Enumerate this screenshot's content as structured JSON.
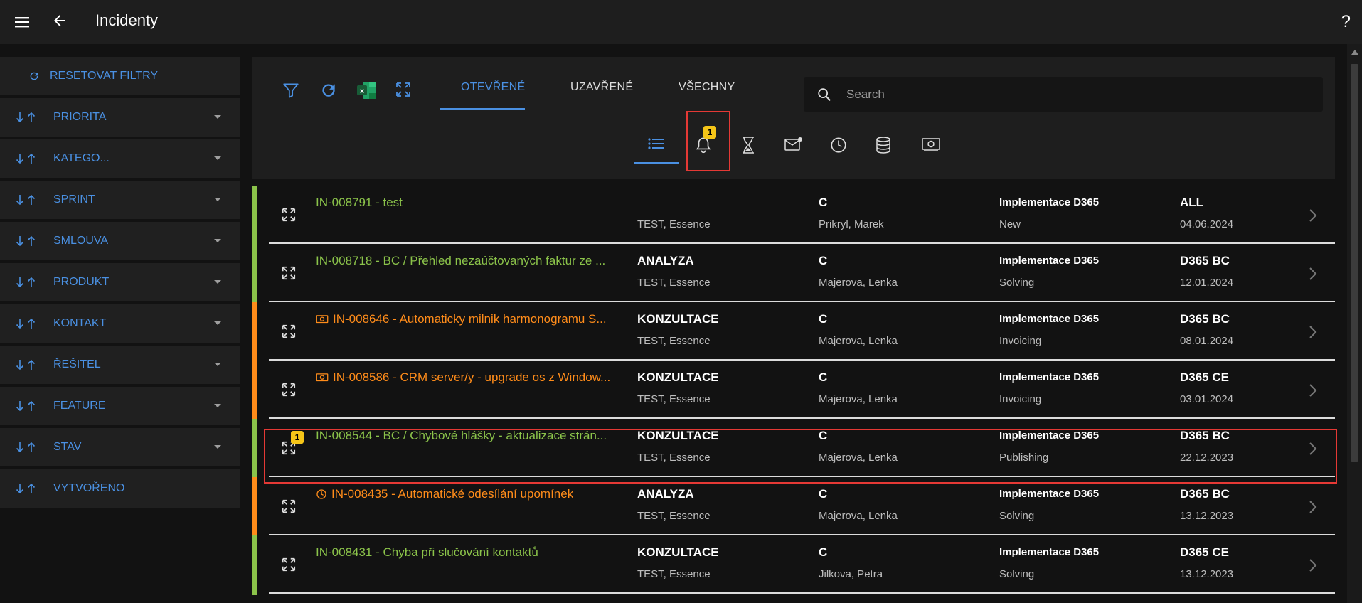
{
  "header": {
    "title": "Incidenty",
    "help": "?"
  },
  "sidebar": {
    "reset_label": "RESETOVAT FILTRY",
    "items": [
      {
        "label": "PRIORITA",
        "has_caret": true
      },
      {
        "label": "KATEGO...",
        "has_caret": true
      },
      {
        "label": "SPRINT",
        "has_caret": true
      },
      {
        "label": "SMLOUVA",
        "has_caret": true
      },
      {
        "label": "PRODUKT",
        "has_caret": true
      },
      {
        "label": "KONTAKT",
        "has_caret": true
      },
      {
        "label": "ŘEŠITEL",
        "has_caret": true
      },
      {
        "label": "FEATURE",
        "has_caret": true
      },
      {
        "label": "STAV",
        "has_caret": true
      },
      {
        "label": "VYTVOŘENO",
        "has_caret": false
      }
    ]
  },
  "tabs": [
    {
      "label": "OTEVŘENÉ",
      "active": true
    },
    {
      "label": "UZAVŘENÉ",
      "active": false
    },
    {
      "label": "VŠECHNY",
      "active": false
    }
  ],
  "search": {
    "placeholder": "Search"
  },
  "views": {
    "bell_badge": "1"
  },
  "colors": {
    "accent": "#4a90e2",
    "green": "#8bc34a",
    "orange": "#ff8c1a",
    "highlight": "#e53935",
    "badge": "#f5c518"
  },
  "rows": [
    {
      "id_title": "IN-008791 - test",
      "color": "green",
      "icon": "",
      "category": "",
      "customer": "TEST, Essence",
      "priority": "C",
      "owner": "Prikryl, Marek",
      "project": "Implementace D365",
      "status": "New",
      "product": "ALL",
      "date": "04.06.2024",
      "badge": ""
    },
    {
      "id_title": "IN-008718 - BC / Přehled nezaúčtovaných faktur ze ...",
      "color": "green",
      "icon": "",
      "category": "ANALYZA",
      "customer": "TEST, Essence",
      "priority": "C",
      "owner": "Majerova, Lenka",
      "project": "Implementace D365",
      "status": "Solving",
      "product": "D365 BC",
      "date": "12.01.2024",
      "badge": ""
    },
    {
      "id_title": "IN-008646 - Automaticky milnik harmonogramu S...",
      "color": "orange",
      "icon": "money",
      "category": "KONZULTACE",
      "customer": "TEST, Essence",
      "priority": "C",
      "owner": "Majerova, Lenka",
      "project": "Implementace D365",
      "status": "Invoicing",
      "product": "D365 BC",
      "date": "08.01.2024",
      "badge": ""
    },
    {
      "id_title": "IN-008586 - CRM server/y - upgrade os z Window...",
      "color": "orange",
      "icon": "money",
      "category": "KONZULTACE",
      "customer": "TEST, Essence",
      "priority": "C",
      "owner": "Majerova, Lenka",
      "project": "Implementace D365",
      "status": "Invoicing",
      "product": "D365 CE",
      "date": "03.01.2024",
      "badge": ""
    },
    {
      "id_title": "IN-008544 - BC / Chybové hlášky - aktualizace strán...",
      "color": "green",
      "icon": "",
      "category": "KONZULTACE",
      "customer": "TEST, Essence",
      "priority": "C",
      "owner": "Majerova, Lenka",
      "project": "Implementace D365",
      "status": "Publishing",
      "product": "D365 BC",
      "date": "22.12.2023",
      "badge": "1"
    },
    {
      "id_title": "IN-008435 - Automatické odesílání upomínek",
      "color": "orange",
      "icon": "clock",
      "category": "ANALYZA",
      "customer": "TEST, Essence",
      "priority": "C",
      "owner": "Majerova, Lenka",
      "project": "Implementace D365",
      "status": "Solving",
      "product": "D365 BC",
      "date": "13.12.2023",
      "badge": ""
    },
    {
      "id_title": "IN-008431 - Chyba při slučování kontaktů",
      "color": "green",
      "icon": "",
      "category": "KONZULTACE",
      "customer": "TEST, Essence",
      "priority": "C",
      "owner": "Jilkova, Petra",
      "project": "Implementace D365",
      "status": "Solving",
      "product": "D365 CE",
      "date": "13.12.2023",
      "badge": ""
    }
  ]
}
